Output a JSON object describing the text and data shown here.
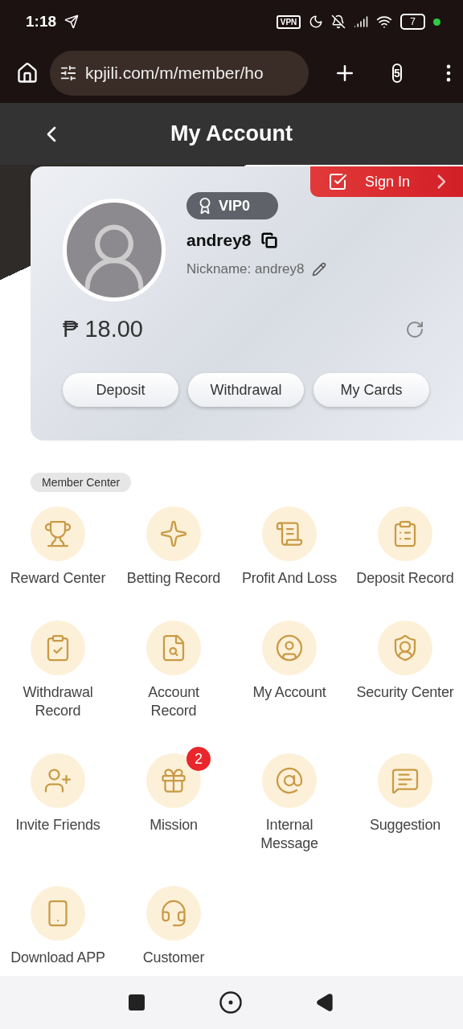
{
  "status_bar": {
    "time": "1:18",
    "vpn": "VPN",
    "battery": "7"
  },
  "browser": {
    "url": "kpjili.com/m/member/ho",
    "tab_count": "5"
  },
  "header": {
    "title": "My Account"
  },
  "profile": {
    "sign_in": "Sign In",
    "vip": "VIP0",
    "username": "andrey8",
    "nickname": "Nickname: andrey8",
    "balance": "₱ 18.00",
    "buttons": [
      "Deposit",
      "Withdrawal",
      "My Cards"
    ]
  },
  "member_center": {
    "title": "Member Center",
    "items": [
      {
        "label": "Reward Center"
      },
      {
        "label": "Betting Record"
      },
      {
        "label": "Profit And Loss"
      },
      {
        "label": "Deposit Record"
      },
      {
        "label": "Withdrawal Record"
      },
      {
        "label": "Account Record"
      },
      {
        "label": "My Account"
      },
      {
        "label": "Security Center"
      },
      {
        "label": "Invite Friends"
      },
      {
        "label": "Mission",
        "badge": "2"
      },
      {
        "label": "Internal Message"
      },
      {
        "label": "Suggestion"
      },
      {
        "label": "Download APP"
      },
      {
        "label": "Customer"
      }
    ]
  }
}
